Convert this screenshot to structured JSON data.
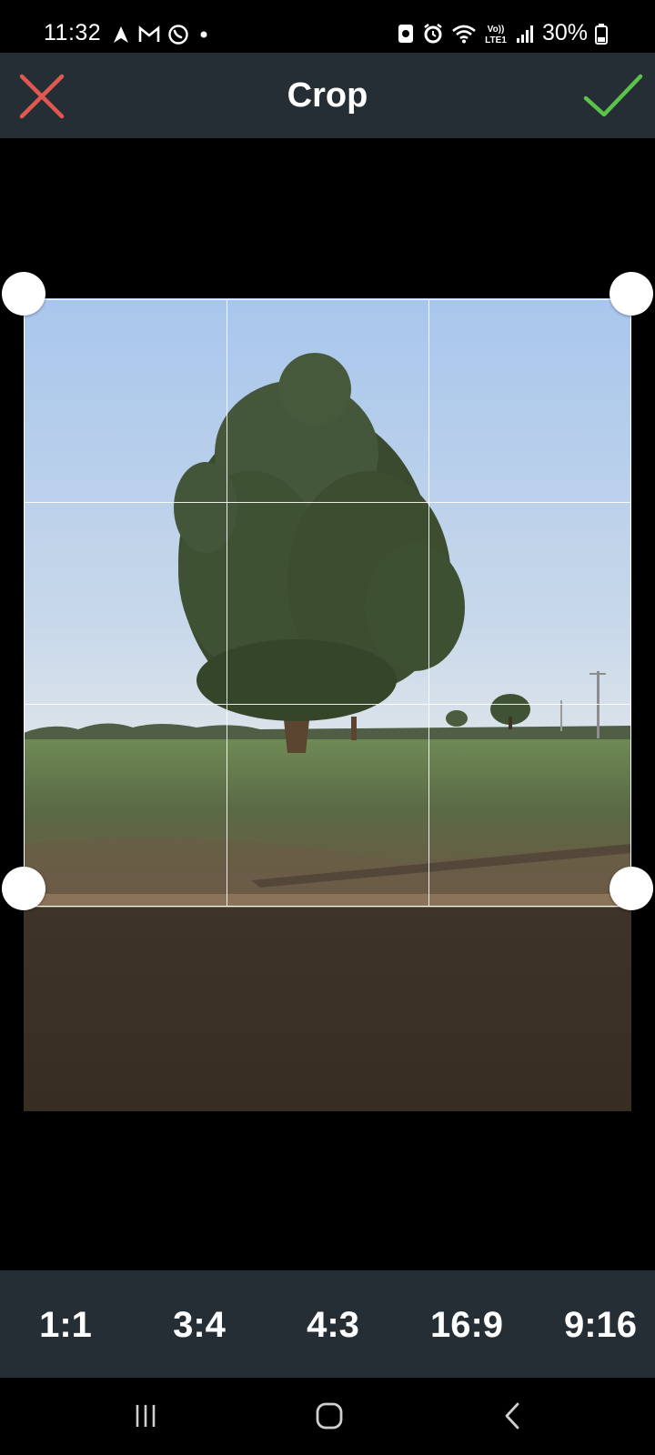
{
  "status_bar": {
    "time": "11:32",
    "battery": "30%",
    "left_icons": [
      "navigation-icon",
      "gmail-icon",
      "whatsapp-icon",
      "dot-icon"
    ],
    "right_icons": [
      "screenshot-icon",
      "alarm-icon",
      "wifi-icon",
      "volte-icon",
      "signal-icon",
      "battery-icon"
    ]
  },
  "header": {
    "title": "Crop",
    "close_icon": "close-icon",
    "confirm_icon": "check-icon",
    "close_color": "#e0584f",
    "confirm_color": "#5cc34a"
  },
  "aspect_ratios": [
    "1:1",
    "3:4",
    "4:3",
    "16:9",
    "9:16"
  ],
  "nav_bar": {
    "icons": [
      "recent-apps-icon",
      "home-icon",
      "back-icon"
    ]
  }
}
